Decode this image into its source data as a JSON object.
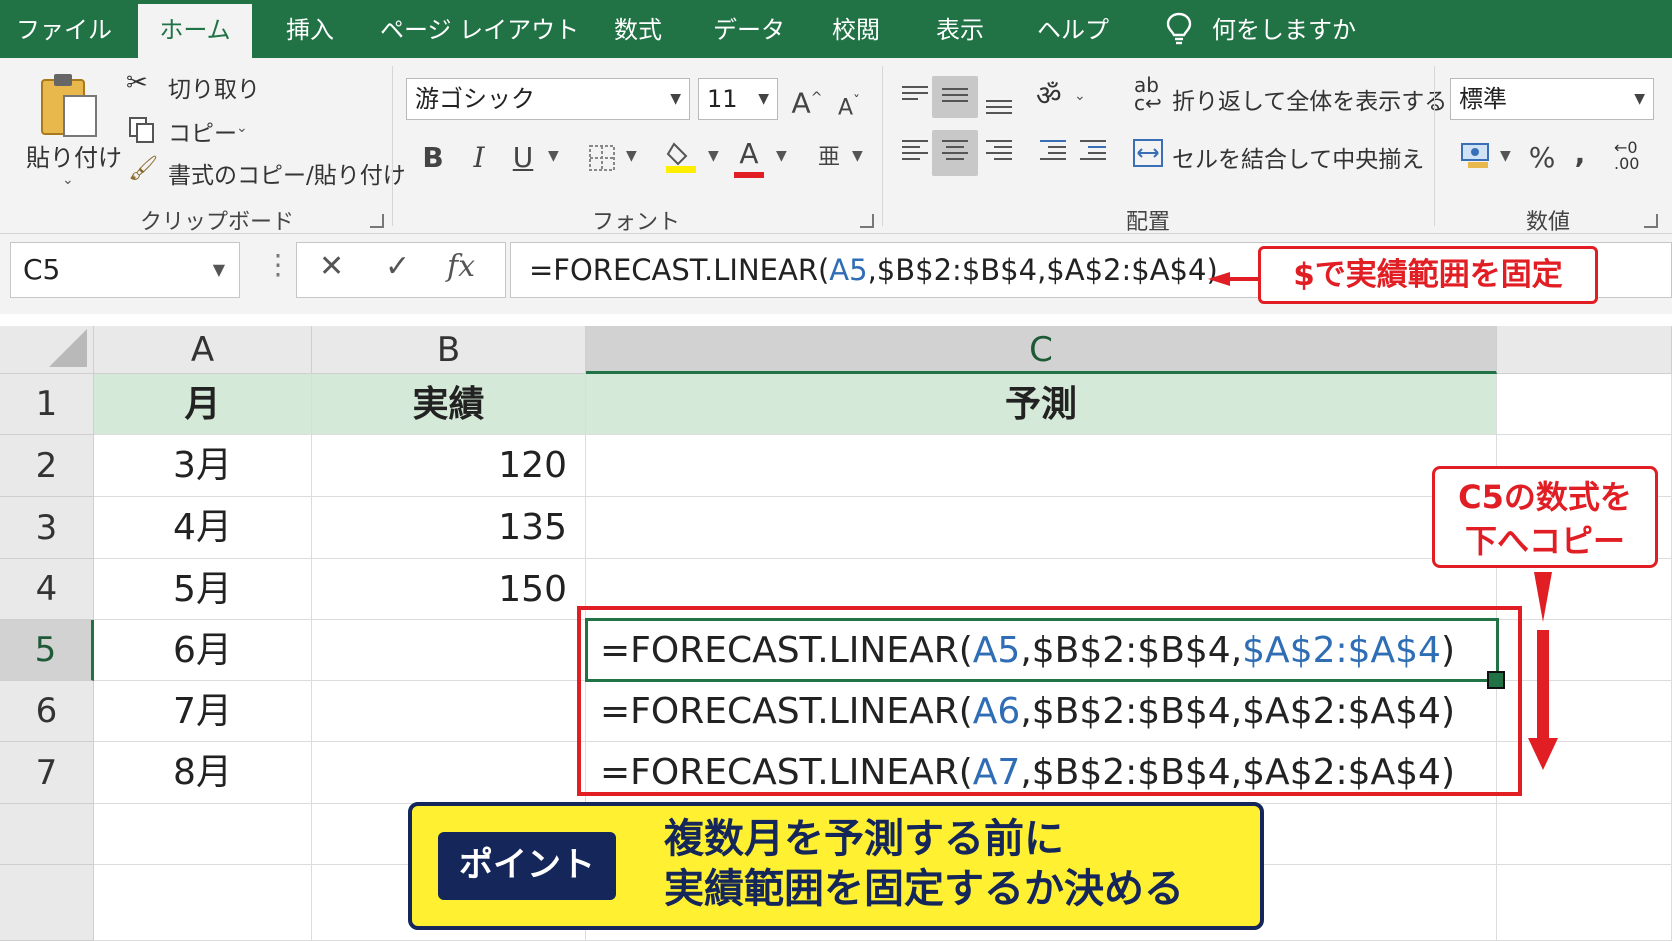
{
  "menu": {
    "tabs": [
      "ファイル",
      "ホーム",
      "挿入",
      "ページ レイアウト",
      "数式",
      "データ",
      "校閲",
      "表示",
      "ヘルプ"
    ],
    "active_tab": "ホーム",
    "tell_me": "何をしますか"
  },
  "ribbon": {
    "clipboard": {
      "paste": "貼り付け",
      "cut": "切り取り",
      "copy": "コピー",
      "format_painter": "書式のコピー/貼り付け",
      "label": "クリップボード"
    },
    "font": {
      "font_name": "游ゴシック",
      "font_size": "11",
      "bold": "B",
      "italic": "I",
      "underline": "U",
      "grow": "A",
      "shrink": "A",
      "font_color": "A",
      "label": "フォント"
    },
    "alignment": {
      "wrap": "折り返して全体を表示する",
      "merge": "セルを結合して中央揃え",
      "label": "配置"
    },
    "number": {
      "format": "標準",
      "percent": "%",
      "comma": ",",
      "label": "数値"
    }
  },
  "formula_bar": {
    "name_box": "C5",
    "fx": "fx",
    "formula_prefix": "=FORECAST.LINEAR(",
    "formula_ref": "A5",
    "formula_suffix": ",$B$2:$B$4,$A$2:$A$4)"
  },
  "annotations": {
    "top_callout": "$で実績範囲を固定",
    "right_callout_line1": "C5の数式を",
    "right_callout_line2": "下へコピー",
    "point_label": "ポイント",
    "point_line1": "複数月を予測する前に",
    "point_line2": "実績範囲を固定するか決める"
  },
  "sheet": {
    "columns": [
      "A",
      "B",
      "C"
    ],
    "rows": [
      "1",
      "2",
      "3",
      "4",
      "5",
      "6",
      "7"
    ],
    "headers": [
      "月",
      "実績",
      "予測"
    ],
    "data": [
      {
        "month": "3月",
        "actual": "120"
      },
      {
        "month": "4月",
        "actual": "135"
      },
      {
        "month": "5月",
        "actual": "150"
      },
      {
        "month": "6月",
        "f_pre": "=FORECAST.LINEAR(",
        "f_ref1": "A5",
        "f_mid": ",$B$2:$B$4,",
        "f_ref2": "$A$2:$A$4",
        "f_end": ")"
      },
      {
        "month": "7月",
        "f_pre": "=FORECAST.LINEAR(",
        "f_ref1": "A6",
        "f_mid": ",$B$2:$B$4,",
        "f_ref2": "$A$2:$A$4",
        "f_end": ")"
      },
      {
        "month": "8月",
        "f_pre": "=FORECAST.LINEAR(",
        "f_ref1": "A7",
        "f_mid": ",$B$2:$B$4,",
        "f_ref2": "$A$2:$A$4",
        "f_end": ")"
      }
    ]
  },
  "colors": {
    "excel_green": "#217346",
    "header_fill": "#d5e9d8",
    "ref_blue": "#2f6db5",
    "callout_red": "#e01e24",
    "point_yellow": "#fff132",
    "point_navy": "#14265a"
  }
}
